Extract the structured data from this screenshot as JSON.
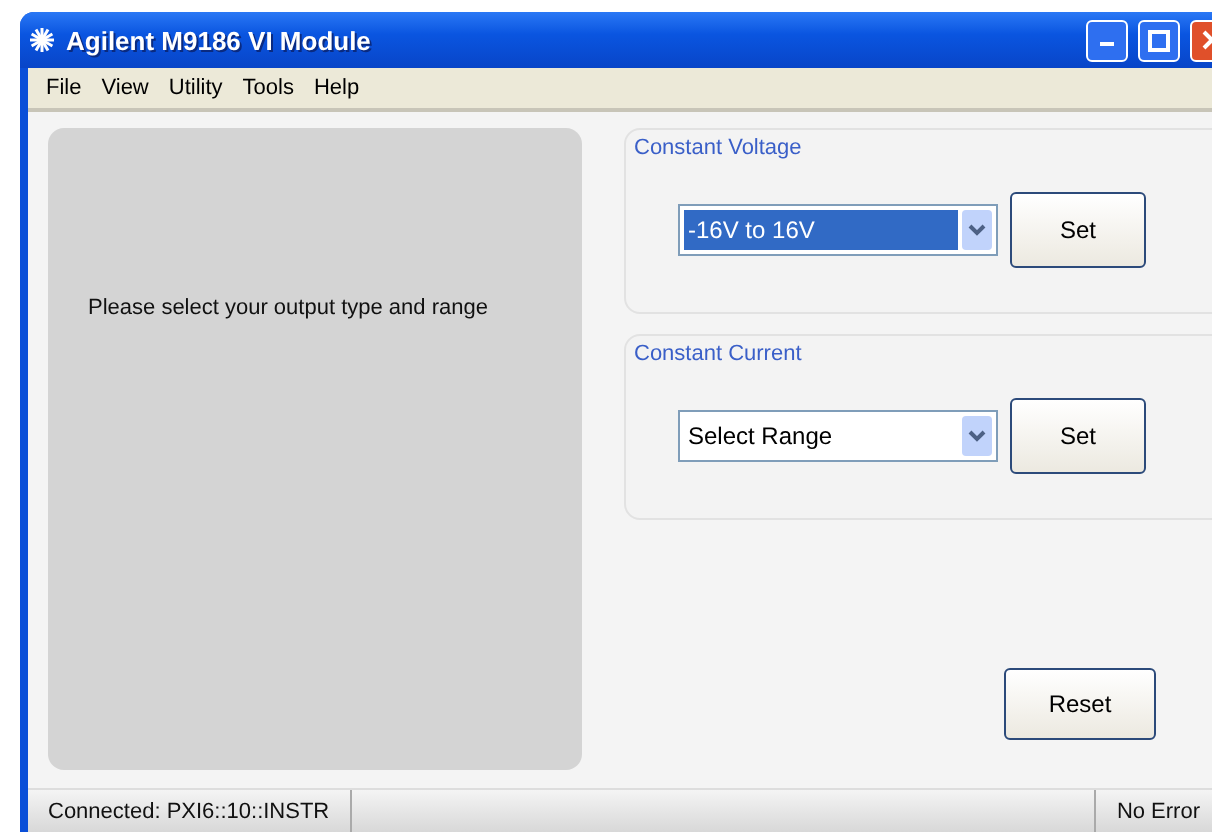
{
  "window": {
    "title": "Agilent M9186 VI Module"
  },
  "menu": [
    "File",
    "View",
    "Utility",
    "Tools",
    "Help"
  ],
  "message": "Please select your output type and range",
  "groups": [
    {
      "title": "Constant Voltage",
      "value": "-16V to 16V",
      "highlighted": true,
      "button": "Set"
    },
    {
      "title": "Constant Current",
      "value": "Select Range",
      "highlighted": false,
      "button": "Set"
    }
  ],
  "reset_button": "Reset",
  "status_bar": {
    "connection": "Connected: PXI6::10::INSTR",
    "error": "No Error"
  }
}
